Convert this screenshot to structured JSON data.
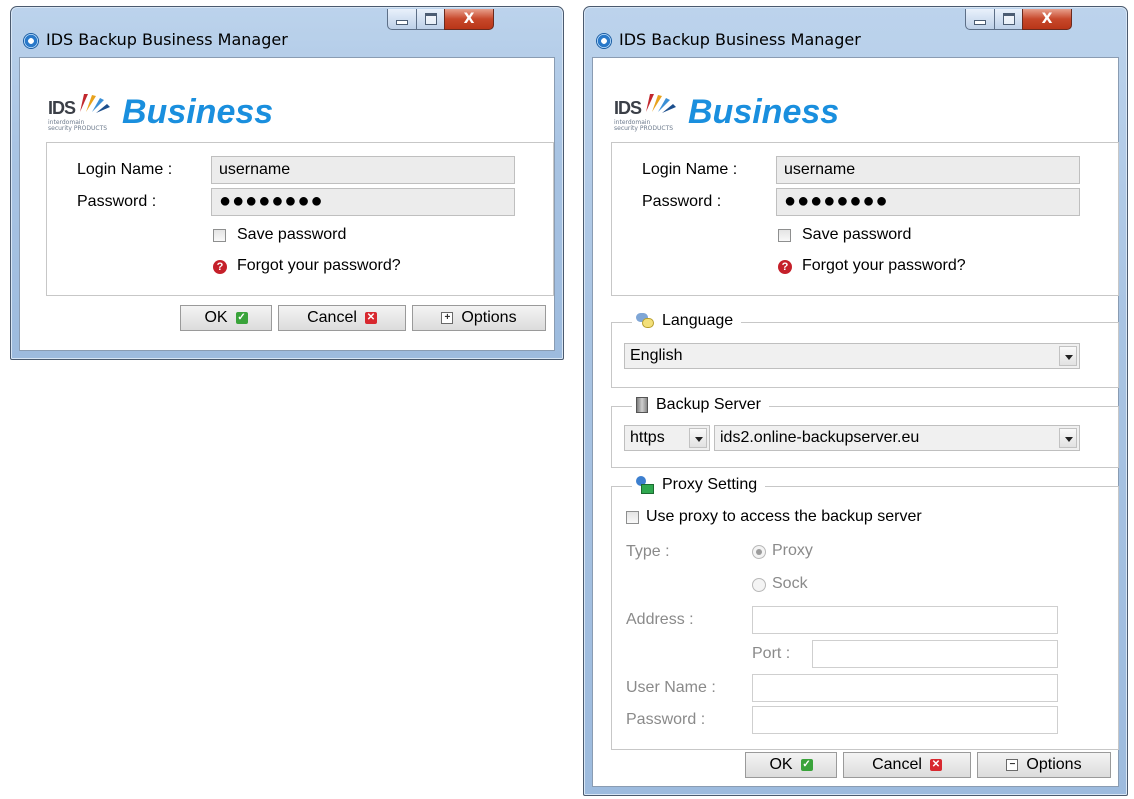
{
  "window_small": {
    "title": "IDS Backup Business Manager",
    "logo": {
      "ids_text": "IDS",
      "tagline": "interdomain security PRODUCTS",
      "brand": "Business"
    },
    "login": {
      "login_name_label": "Login Name :",
      "login_name_value": "username",
      "password_label": "Password :",
      "password_value": "●●●●●●●●",
      "save_password_label": "Save password",
      "save_password_checked": false,
      "forgot_label": "Forgot your password?"
    },
    "buttons": {
      "ok": "OK",
      "cancel": "Cancel",
      "options": "Options",
      "options_state": "expand"
    }
  },
  "window_large": {
    "title": "IDS Backup Business Manager",
    "logo": {
      "ids_text": "IDS",
      "tagline": "interdomain security PRODUCTS",
      "brand": "Business"
    },
    "login": {
      "login_name_label": "Login Name :",
      "login_name_value": "username",
      "password_label": "Password :",
      "password_value": "●●●●●●●●",
      "save_password_label": "Save password",
      "save_password_checked": false,
      "forgot_label": "Forgot your password?"
    },
    "language": {
      "title": "Language",
      "icon": "language-icon",
      "selected": "English"
    },
    "backup_server": {
      "title": "Backup Server",
      "icon": "server-icon",
      "protocol": "https",
      "host": "ids2.online-backupserver.eu"
    },
    "proxy": {
      "title": "Proxy Setting",
      "icon": "proxy-icon",
      "use_proxy_label": "Use proxy to access the backup server",
      "use_proxy_checked": false,
      "type_label": "Type :",
      "type_options": [
        "Proxy",
        "Sock"
      ],
      "type_selected": "Proxy",
      "address_label": "Address :",
      "address_value": "",
      "port_label": "Port :",
      "port_value": "",
      "username_label": "User Name :",
      "username_value": "",
      "password_label": "Password :",
      "password_value": ""
    },
    "buttons": {
      "ok": "OK",
      "cancel": "Cancel",
      "options": "Options",
      "options_state": "collapse"
    }
  },
  "colors": {
    "brand_blue": "#1a8fde",
    "ok_green": "#39a33a",
    "cancel_red": "#d8282f",
    "help_red": "#c5202a"
  }
}
